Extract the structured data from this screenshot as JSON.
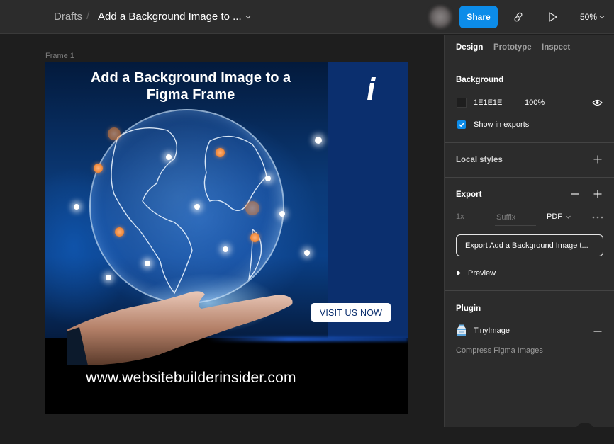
{
  "topbar": {
    "breadcrumb_root": "Drafts",
    "breadcrumb_separator": "/",
    "file_title": "Add a Background Image to ...",
    "share_label": "Share",
    "zoom_level": "50%",
    "icons": {
      "title_menu": "chevron-down-icon",
      "link": "link-icon",
      "present": "play-icon",
      "zoom_menu": "chevron-down-icon"
    }
  },
  "canvas": {
    "frame_label": "Frame 1",
    "artwork": {
      "headline": "Add a Background Image to a Figma Frame",
      "logo_glyph": "i",
      "cta_label": "VISIT US NOW",
      "url": "www.websitebuilderinsider.com",
      "colors": {
        "side_panel": "#0b2f6e",
        "cta_text": "#0b2f6e",
        "bottom_band": "#000000"
      }
    }
  },
  "panel": {
    "tabs": [
      {
        "label": "Design",
        "active": true
      },
      {
        "label": "Prototype",
        "active": false
      },
      {
        "label": "Inspect",
        "active": false
      }
    ],
    "background": {
      "title": "Background",
      "hex": "1E1E1E",
      "opacity": "100%",
      "show_in_exports_label": "Show in exports",
      "show_in_exports": true
    },
    "local_styles": {
      "title": "Local styles"
    },
    "export": {
      "title": "Export",
      "scale": "1x",
      "suffix_placeholder": "Suffix",
      "format": "PDF",
      "button_label": "Export Add a Background Image t...",
      "preview_label": "Preview"
    },
    "plugin": {
      "title": "Plugin",
      "name": "TinyImage",
      "description": "Compress Figma Images"
    }
  },
  "colors": {
    "accent": "#0c8ce9",
    "panel_bg": "#2c2c2c",
    "canvas_bg": "#1e1e1e"
  }
}
